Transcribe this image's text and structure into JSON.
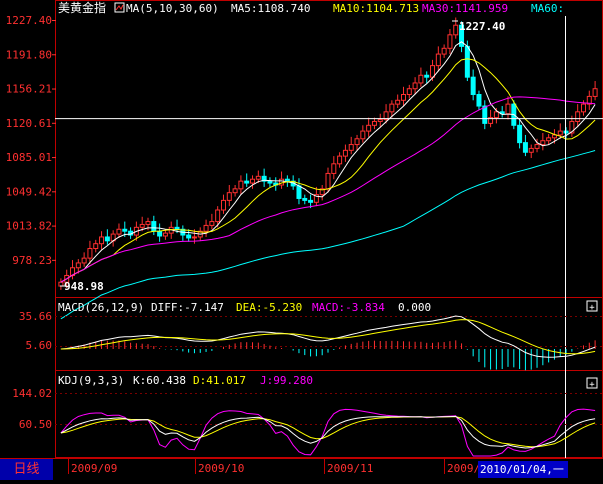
{
  "colors": {
    "up": "#ff3030",
    "down": "#00ffff",
    "ma5": "#ffffff",
    "ma10": "#ffff00",
    "ma30": "#ff00ff",
    "ma60": "#00ffff",
    "axis": "#ff0000",
    "text": "#ffffff"
  },
  "instrument": "美黄金指",
  "period_label": "日线",
  "cursor_date": "2010/01/04,一",
  "price_panel": {
    "indicator_label": "MA(5,10,30,60)",
    "ma5_label": "MA5:1108.740",
    "ma10_label": "MA10:1104.713",
    "ma30_label": "MA30:1141.959",
    "ma60_label": "MA60:",
    "y_ticks": [
      "1227.40",
      "1191.80",
      "1156.21",
      "1120.61",
      "1085.01",
      "1049.42",
      "1013.82",
      "978.23"
    ],
    "y_tick_values": [
      1227.4,
      1191.8,
      1156.21,
      1120.61,
      1085.01,
      1049.42,
      1013.82,
      978.23
    ],
    "high_label": "1227.40",
    "low_label": "948.98",
    "crosshair_price": 1125.0
  },
  "macd_panel": {
    "label": "MACD(26,12,9)",
    "diff_label": "DIFF:-7.147",
    "dea_label": "DEA:-5.230",
    "macd_label": "MACD:-3.834",
    "extra_label": "0.000",
    "y_ticks": [
      "35.66",
      "5.60"
    ]
  },
  "kdj_panel": {
    "label": "KDJ(9,3,3)",
    "k_label": "K:60.438",
    "d_label": "D:41.017",
    "j_label": "J:99.280",
    "y_ticks": [
      "144.02",
      "60.50"
    ]
  },
  "x_axis": {
    "labels": [
      "2009/09",
      "2009/10",
      "2009/11",
      "2009/"
    ]
  },
  "chart_data": {
    "type": "candlestick",
    "title": "美黄金指",
    "closes": [
      955,
      962,
      970,
      975,
      980,
      990,
      995,
      1002,
      998,
      1005,
      1010,
      1008,
      1004,
      1012,
      1015,
      1018,
      1008,
      1003,
      1006,
      1012,
      1010,
      1004,
      1001,
      1002,
      1008,
      1014,
      1018,
      1030,
      1040,
      1048,
      1052,
      1060,
      1058,
      1062,
      1065,
      1060,
      1058,
      1056,
      1062,
      1060,
      1055,
      1042,
      1040,
      1038,
      1046,
      1052,
      1068,
      1078,
      1086,
      1092,
      1098,
      1104,
      1112,
      1118,
      1122,
      1124,
      1132,
      1140,
      1144,
      1150,
      1156,
      1162,
      1170,
      1168,
      1180,
      1192,
      1198,
      1212,
      1222,
      1200,
      1168,
      1150,
      1138,
      1120,
      1126,
      1132,
      1130,
      1140,
      1118,
      1100,
      1090,
      1094,
      1098,
      1102,
      1105,
      1108,
      1112,
      1110,
      1122,
      1132,
      1140,
      1148,
      1156
    ],
    "ma5_last": 1108.74,
    "ma10_last": 1104.713,
    "ma30_last": 1141.959,
    "high": 1227.4,
    "low": 948.98
  }
}
